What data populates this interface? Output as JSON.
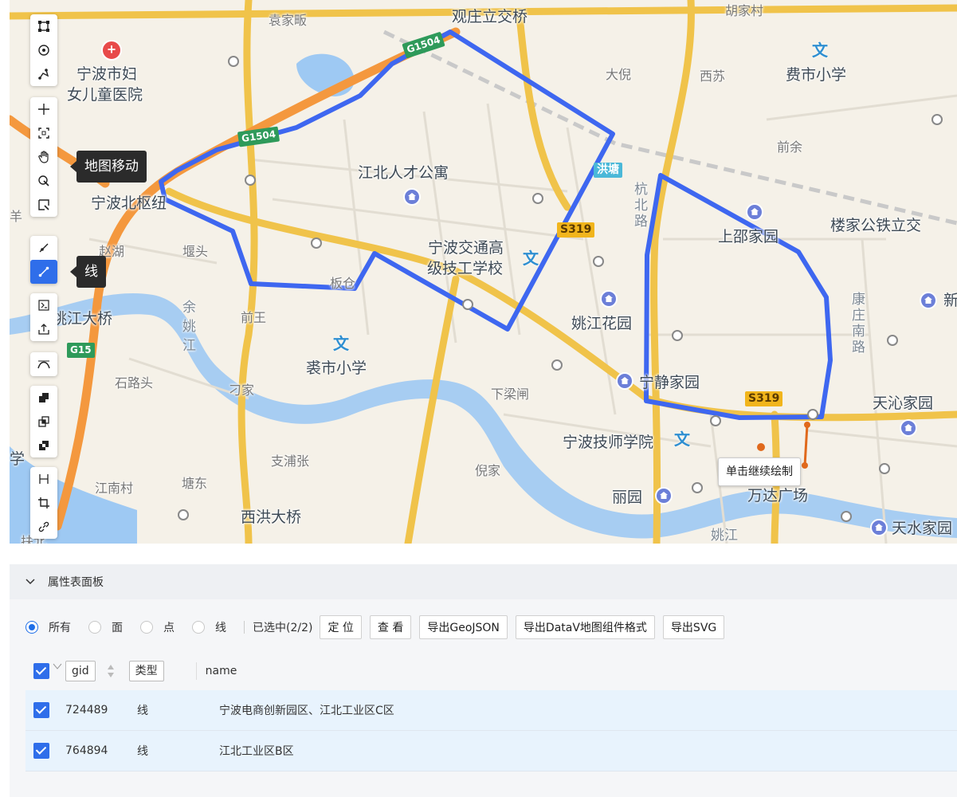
{
  "map": {
    "labels": {
      "l1": "袁家畈",
      "l2": "观庄立交桥",
      "l3": "胡家村",
      "l4": "宁波市妇",
      "l5": "女儿童医院",
      "l6": "大倪",
      "l7": "西苏",
      "l8": "费市小学",
      "l9": "前余",
      "l10": "江北人才公寓",
      "l11": "洪塘",
      "l12": "宁波北枢纽",
      "l13": "上邵家园",
      "l14": "楼家公铁立交",
      "l15": "堰头",
      "l16": "宁波交通高",
      "l17": "级技工学校",
      "l18": "姚江大桥",
      "l19": "前王",
      "l20": "姚江花园",
      "l21": "康庄南路",
      "l22": "新",
      "l23": "余姚江",
      "l24": "裘市小学",
      "l25": "宁静家园",
      "l26": "石路头",
      "l27": "刁家",
      "l28": "下梁闸",
      "l29": "天沁家园",
      "l30": "宁波技师学院",
      "l31": "学",
      "l32": "支浦张",
      "l33": "倪家",
      "l34": "江南村",
      "l35": "塘东",
      "l36": "西洪大桥",
      "l37": "丽园",
      "l38": "万达广场",
      "l39": "天水家园",
      "l40": "姚江",
      "l41": "杭北路",
      "l42": "羊",
      "l43": "赵湖",
      "l44": "板仓",
      "l45": "扶北"
    },
    "shields": {
      "s1": "S319",
      "s2": "S319",
      "g1": "G1504",
      "g2": "G1504",
      "g3": "G15"
    },
    "hint": "单击继续绘制",
    "polygon_color": "#3e67f0"
  },
  "toolbar": {
    "tooltip_move": "地图移动",
    "tooltip_line": "线",
    "icons": [
      "rect-select-icon",
      "circle-select-icon",
      "polyline-select-icon",
      "crosshair-icon",
      "zoom-fit-icon",
      "hand-icon",
      "point-edit-icon",
      "polygon-edit-icon",
      "draw-line-icon",
      "draw-polyline-icon",
      "terminal-icon",
      "upload-icon",
      "curve-icon",
      "union-icon",
      "intersect-icon",
      "difference-icon",
      "split-icon",
      "crop-icon",
      "link-icon"
    ]
  },
  "panel": {
    "title": "属性表面板",
    "filters": {
      "all": "所有",
      "face": "面",
      "point": "点",
      "line": "线"
    },
    "selected": "已选中(2/2)",
    "buttons": {
      "locate": "定 位",
      "view": "查 看",
      "geojson": "导出GeoJSON",
      "datav": "导出DataV地图组件格式",
      "svg": "导出SVG"
    },
    "columns": {
      "gid": "gid",
      "type": "类型",
      "name": "name"
    },
    "rows": [
      {
        "gid": "724489",
        "type": "线",
        "name": "宁波电商创新园区、江北工业区C区"
      },
      {
        "gid": "764894",
        "type": "线",
        "name": "江北工业区B区"
      }
    ]
  }
}
